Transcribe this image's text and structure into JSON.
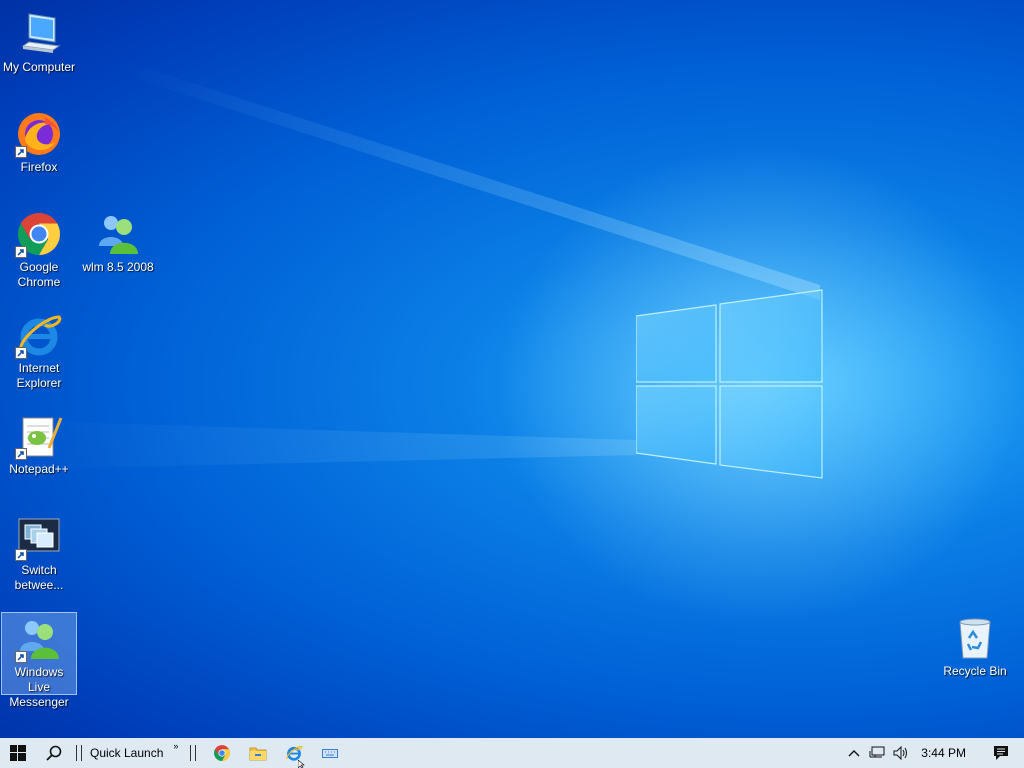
{
  "desktop": {
    "icons": [
      {
        "label": "My Computer",
        "icon": "computer-icon",
        "shortcut": false
      },
      {
        "label": "Firefox",
        "icon": "firefox-icon",
        "shortcut": true
      },
      {
        "label": "Google Chrome",
        "icon": "chrome-icon",
        "shortcut": true
      },
      {
        "label": "wlm 8.5 2008",
        "icon": "messenger-icon",
        "shortcut": false
      },
      {
        "label": "Internet Explorer",
        "icon": "internet-explorer-icon",
        "shortcut": true
      },
      {
        "label": "Notepad++",
        "icon": "notepad-plus-plus-icon",
        "shortcut": true
      },
      {
        "label": "Switch betwee...",
        "icon": "switch-windows-icon",
        "shortcut": true
      },
      {
        "label": "Windows Live Messenger",
        "icon": "messenger-icon",
        "shortcut": true,
        "selected": true
      },
      {
        "label": "Recycle Bin",
        "icon": "recycle-bin-icon",
        "shortcut": false
      }
    ]
  },
  "taskbar": {
    "quick_launch_label": "Quick Launch",
    "overflow_chevron": "»",
    "pinned": [
      "chrome-icon",
      "file-explorer-icon",
      "internet-explorer-icon",
      "keyboard-icon"
    ],
    "tray": {
      "icons": [
        "chevron-up-icon",
        "network-icon",
        "volume-icon"
      ],
      "clock": "3:44 PM",
      "notification_icon": "action-center-icon"
    }
  },
  "colors": {
    "wallpaper_blue": "#0061d6",
    "taskbar_bg": "#dfe9f2",
    "selection": "#add8ff"
  }
}
